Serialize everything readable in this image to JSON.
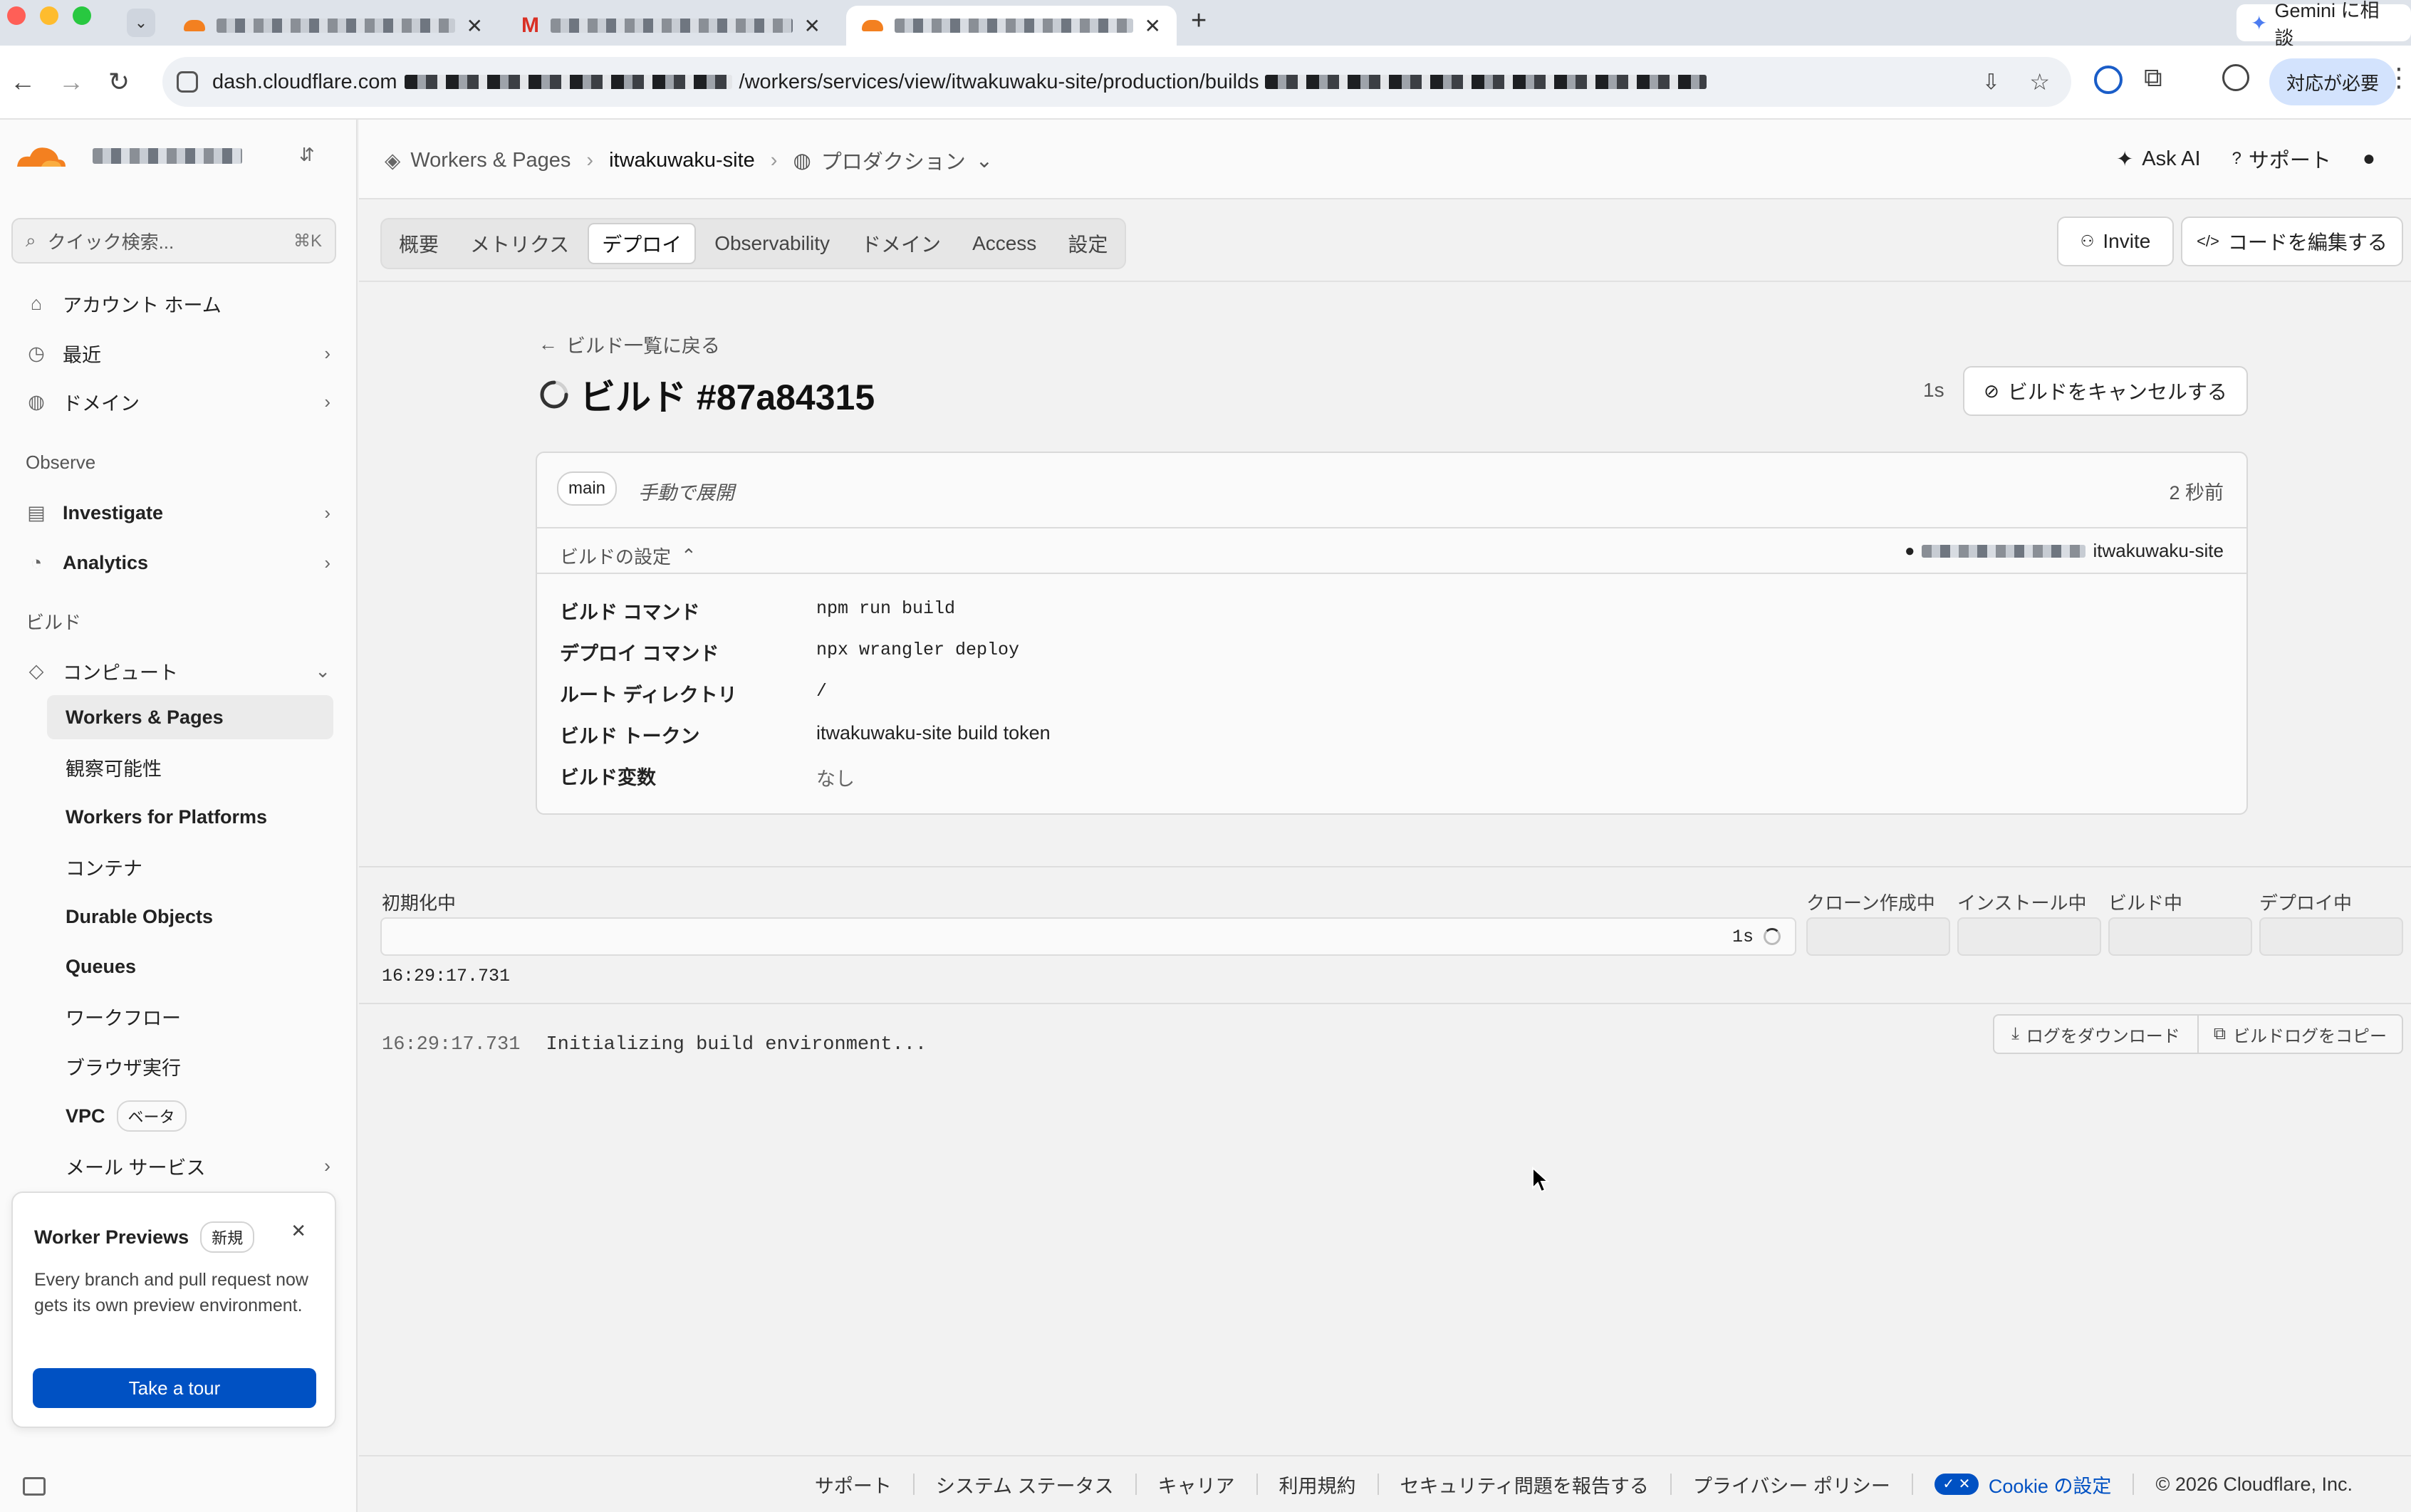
{
  "browser": {
    "tabs": [
      {
        "title": ""
      },
      {
        "title": ""
      },
      {
        "title": ""
      }
    ],
    "new_tab": "+",
    "gemini_label": "Gemini に相談",
    "url_host": "dash.cloudflare.com",
    "url_path": "/workers/services/view/itwakuwaku-site/production/builds",
    "profile_button": "対応が必要"
  },
  "sidebar": {
    "search_placeholder": "クイック検索...",
    "search_shortcut": "⌘K",
    "items_top": [
      {
        "label": "アカウント ホーム",
        "icon": "home-icon"
      },
      {
        "label": "最近",
        "icon": "history-icon"
      },
      {
        "label": "ドメイン",
        "icon": "globe-icon"
      }
    ],
    "observe_heading": "Observe",
    "observe_items": [
      {
        "label": "Investigate",
        "icon": "investigate-icon"
      },
      {
        "label": "Analytics",
        "icon": "analytics-icon"
      }
    ],
    "build_heading": "ビルド",
    "compute_label": "コンピュート",
    "compute_items": [
      "Workers & Pages",
      "観察可能性",
      "Workers for Platforms",
      "コンテナ",
      "Durable Objects",
      "Queues",
      "ワークフロー",
      "ブラウザ実行",
      "VPC",
      "メール サービス"
    ],
    "vpc_badge": "ベータ",
    "promo": {
      "title": "Worker Previews",
      "badge": "新規",
      "text": "Every branch and pull request now gets its own preview environment.",
      "button": "Take a tour"
    }
  },
  "header": {
    "breadcrumb_root": "Workers & Pages",
    "breadcrumb_worker": "itwakuwaku-site",
    "environment": "プロダクション",
    "ask_ai": "Ask AI",
    "support": "サポート"
  },
  "tabs": [
    "概要",
    "メトリクス",
    "デプロイ",
    "Observability",
    "ドメイン",
    "Access",
    "設定"
  ],
  "active_tab": "デプロイ",
  "actions": {
    "invite": "Invite",
    "edit_code": "コードを編集する"
  },
  "build": {
    "back_link": "ビルド一覧に戻る",
    "title": "ビルド #87a84315",
    "elapsed": "1s",
    "cancel_button": "ビルドをキャンセルする",
    "branch": "main",
    "trigger": "手動で展開",
    "time_ago": "2 秒前",
    "settings_toggle": "ビルドの設定",
    "repo": "itwakuwaku-site",
    "settings": [
      {
        "key": "ビルド コマンド",
        "value": "npm run build",
        "mono": true
      },
      {
        "key": "デプロイ コマンド",
        "value": "npx wrangler deploy",
        "mono": true
      },
      {
        "key": "ルート ディレクトリ",
        "value": "/",
        "mono": true
      },
      {
        "key": "ビルド トークン",
        "value": "itwakuwaku-site build token",
        "mono": false
      },
      {
        "key": "ビルド変数",
        "value": "なし",
        "mono": false
      }
    ]
  },
  "stages": {
    "current": "初期化中",
    "current_elapsed": "1s",
    "current_time": "16:29:17.731",
    "pending": [
      "クローン作成中",
      "インストール中",
      "ビルド中",
      "デプロイ中"
    ]
  },
  "log": {
    "download_button": "ログをダウンロード",
    "copy_button": "ビルドログをコピー",
    "lines": [
      {
        "time": "16:29:17.731",
        "text": "Initializing build environment..."
      }
    ]
  },
  "footer": {
    "links": [
      "サポート",
      "システム ステータス",
      "キャリア",
      "利用規約",
      "セキュリティ問題を報告する",
      "プライバシー ポリシー"
    ],
    "cookie": "Cookie の設定",
    "copyright": "© 2026 Cloudflare, Inc."
  },
  "colors": {
    "brand": "#f38020",
    "accent": "#0051c3",
    "link": "#0051c3"
  }
}
